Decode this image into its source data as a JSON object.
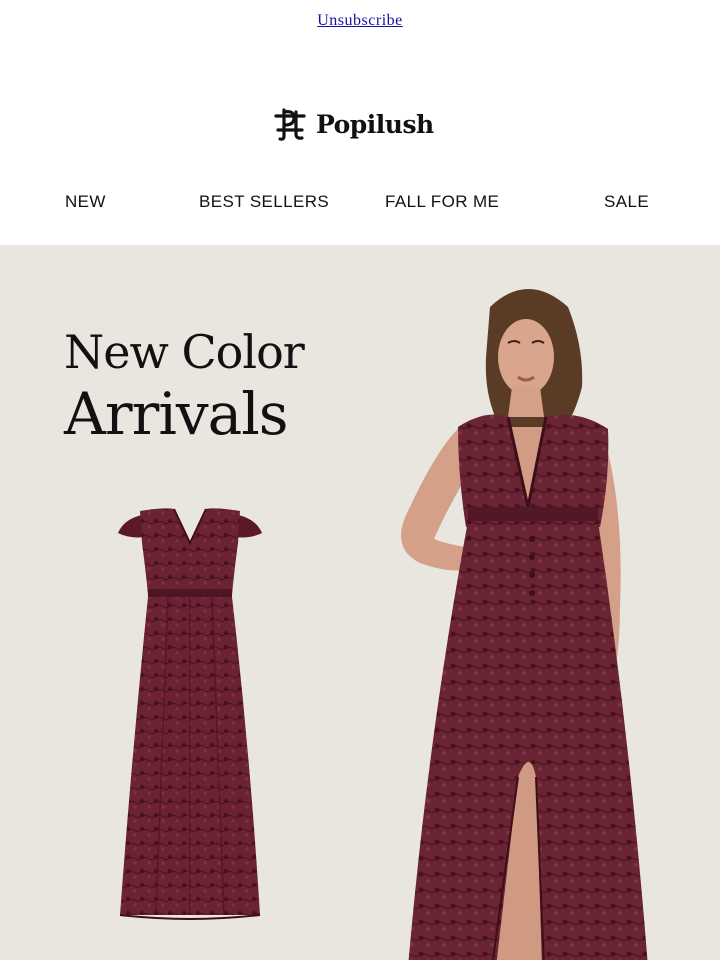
{
  "header": {
    "unsubscribe_label": "Unsubscribe",
    "brand": "Popilush"
  },
  "nav": {
    "items": [
      {
        "label": "NEW"
      },
      {
        "label": "BEST SELLERS"
      },
      {
        "label": "FALL FOR ME"
      },
      {
        "label": "SALE"
      }
    ]
  },
  "hero": {
    "headline_line1": "New Color",
    "headline_line2": "Arrivals",
    "background_color": "#e9e5df",
    "dress_color": "#5c1a2a"
  }
}
